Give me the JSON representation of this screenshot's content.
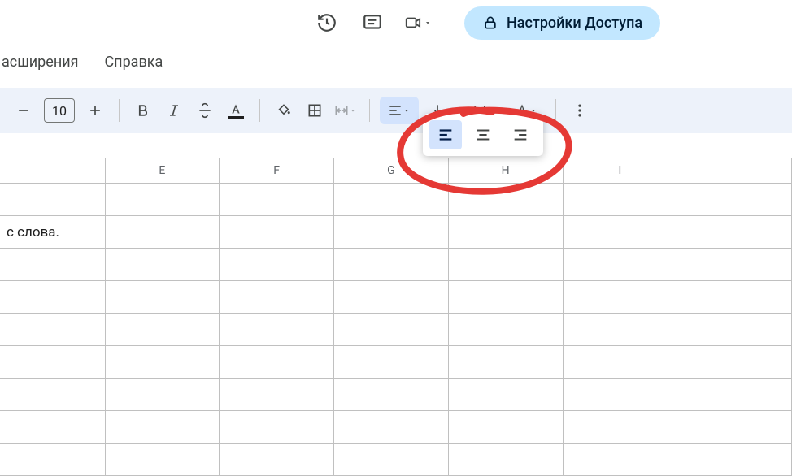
{
  "menubar": {
    "extensions": "асширения",
    "help": "Справка"
  },
  "share": {
    "label": "Настройки Доступа"
  },
  "toolbar": {
    "font_size": "10"
  },
  "columns": [
    "",
    "E",
    "F",
    "G",
    "H",
    "I",
    ""
  ],
  "cells": {
    "r1c0": "с слова."
  }
}
